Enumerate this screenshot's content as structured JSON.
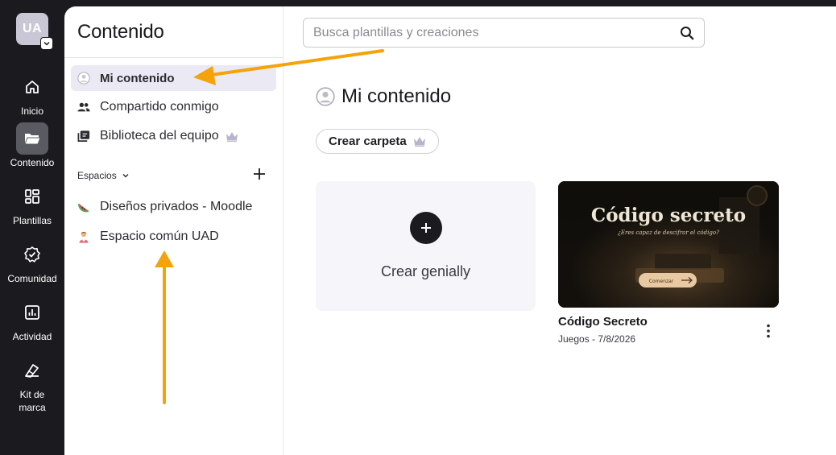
{
  "user": {
    "initials": "UA"
  },
  "rail": {
    "items": [
      {
        "label": "Inicio",
        "icon": "home-icon"
      },
      {
        "label": "Contenido",
        "icon": "folder-icon",
        "active": true
      },
      {
        "label": "Plantillas",
        "icon": "templates-icon"
      },
      {
        "label": "Comunidad",
        "icon": "community-badge-icon"
      },
      {
        "label": "Actividad",
        "icon": "activity-chart-icon"
      },
      {
        "label": "Kit de\nmarca",
        "icon": "brand-kit-icon"
      }
    ]
  },
  "panel": {
    "title": "Contenido",
    "nav": [
      {
        "label": "Mi contenido",
        "icon": "user-circle-icon",
        "active": true
      },
      {
        "label": "Compartido conmigo",
        "icon": "people-icon"
      },
      {
        "label": "Biblioteca del equipo",
        "icon": "library-icon",
        "premium": true
      }
    ],
    "spaces_label": "Espacios",
    "spaces": [
      {
        "label": "Diseños privados - Moodle",
        "icon": "watermelon-icon"
      },
      {
        "label": "Espacio común UAD",
        "icon": "person-emoji-icon"
      }
    ]
  },
  "search": {
    "placeholder": "Busca plantillas y creaciones",
    "value": ""
  },
  "main": {
    "title": "Mi contenido",
    "folder_button": "Crear carpeta",
    "create_card_label": "Crear genially",
    "cards": [
      {
        "title": "Código Secreto",
        "meta": "Juegos - 7/8/2026",
        "thumb_title": "Código secreto",
        "thumb_subtitle": "¿Eres capaz de descifrar el código?",
        "thumb_button": "Comenzar"
      }
    ]
  },
  "colors": {
    "rail_bg": "#1b1b1f",
    "arrow": "#f5a30a",
    "active_nav": "#ebe9f3",
    "premium_crown": "#b8b4cc"
  }
}
